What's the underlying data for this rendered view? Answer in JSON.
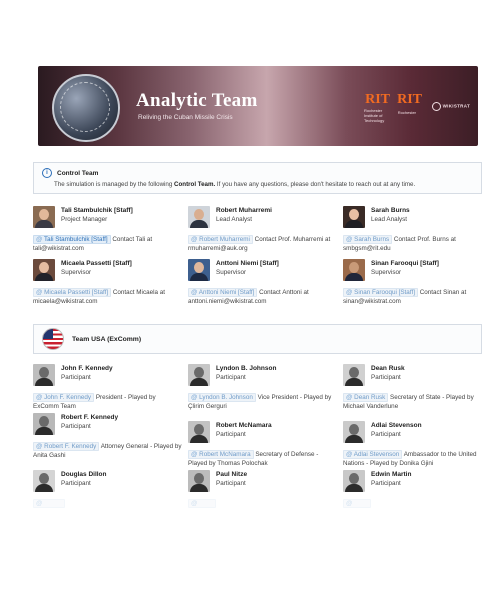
{
  "banner": {
    "title": "Analytic Team",
    "subtitle": "Reliving the Cuban Missile Crisis",
    "logo1": "RIT",
    "logo1_sub": "Rochester Institute of Technology",
    "logo2": "RIT",
    "logo2_sub": "Rochester",
    "logo3": "WIKISTRAT"
  },
  "control": {
    "title": "Control Team",
    "text_prefix": "The simulation is managed by the following ",
    "text_bold": "Control Team.",
    "text_suffix": " If you have any questions, please don't hesitate to reach out at any time."
  },
  "control_people": [
    {
      "name": "Tali Stambulchik [Staff]",
      "role": "Project Manager",
      "tag": "Tali Stambulchik [Staff]",
      "desc": " Contact Tali at tali@wikistrat.com"
    },
    {
      "name": "Robert Muharremi",
      "role": "Lead Analyst",
      "tag": "Robert Muharremi",
      "desc": " Contact Prof. Muharremi at rmuharremi@auk.org"
    },
    {
      "name": "Sarah Burns",
      "role": "Lead Analyst",
      "tag": "Sarah Burns",
      "desc": " Contact Prof. Burns at smbgsm@rit.edu"
    },
    {
      "name": "Micaela Passetti [Staff]",
      "role": "Supervisor",
      "tag": "Micaela Passetti [Staff]",
      "desc": " Contact Micaela at micaela@wikistrat.com"
    },
    {
      "name": "Anttoni Niemi [Staff]",
      "role": "Supervisor",
      "tag": "Anttoni Niemi [Staff]",
      "desc": " Contact Anttoni at anttoni.niemi@wikistrat.com"
    },
    {
      "name": "Sinan Farooqui [Staff]",
      "role": "Supervisor",
      "tag": "Sinan Farooqui [Staff]",
      "desc": " Contact Sinan at sinan@wikistrat.com"
    }
  ],
  "team": {
    "title": "Team USA (ExComm)"
  },
  "team_people": [
    {
      "name": "John F. Kennedy",
      "role": "Participant",
      "tag": "John F. Kennedy",
      "desc": " President - Played by ExComm Team"
    },
    {
      "name": "Lyndon B. Johnson",
      "role": "Participant",
      "tag": "Lyndon B. Johnson",
      "desc": " Vice President - Played by Çlirim Gerguri"
    },
    {
      "name": "Dean Rusk",
      "role": "Participant",
      "tag": "Dean Rusk",
      "desc": " Secretary of State - Played by Michael Vanderlune"
    },
    {
      "name": "Robert F. Kennedy",
      "role": "Participant",
      "tag": "Robert F. Kennedy",
      "desc": " Attorney General - Played by Anita Gashi"
    },
    {
      "name": "Robert McNamara",
      "role": "Participant",
      "tag": "Robert McNamara",
      "desc": " Secretary of Defense - Played by Thomas Polochak"
    },
    {
      "name": "Adlai Stevenson",
      "role": "Participant",
      "tag": "Adlai Stevenson",
      "desc": " Ambassador to the United Nations - Played by Donika Gjini"
    },
    {
      "name": "Douglas Dillon",
      "role": "Participant"
    },
    {
      "name": "Paul Nitze",
      "role": "Participant"
    },
    {
      "name": "Edwin Martin",
      "role": "Participant"
    }
  ],
  "colors": {
    "tag_bg": "#e4eef8",
    "tag_text": "#2f72b8",
    "logo_orange": "#f26b21"
  }
}
